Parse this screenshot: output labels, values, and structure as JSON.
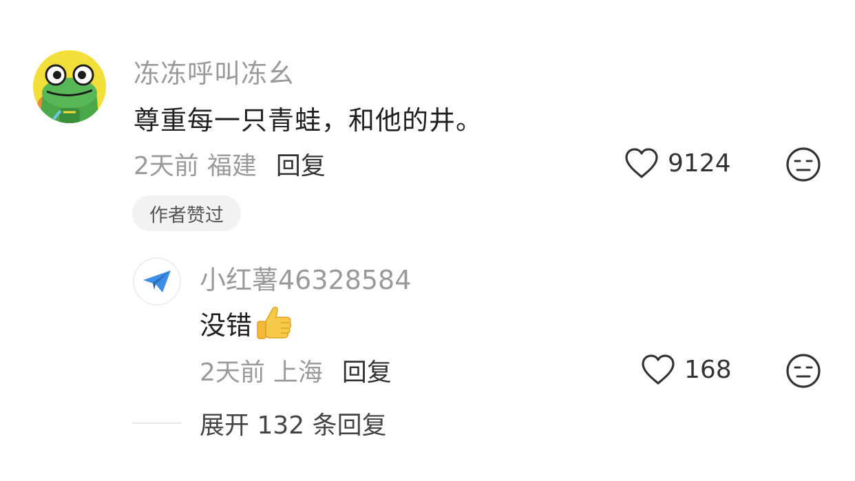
{
  "comment": {
    "username": "冻冻呼叫冻幺",
    "text": "尊重每一只青蛙，和他的井。",
    "time": "2天前",
    "location": "福建",
    "reply_label": "回复",
    "like_count": "9124",
    "author_badge": "作者赞过",
    "avatar_icon": "frog-avatar"
  },
  "reply": {
    "username": "小红薯46328584",
    "text": "没错",
    "emoji": "thumbs-up",
    "time": "2天前",
    "location": "上海",
    "reply_label": "回复",
    "like_count": "168",
    "avatar_icon": "paper-plane-icon"
  },
  "expand_label": "展开 132 条回复",
  "icons": {
    "like": "heart-outline-icon",
    "dislike": "neutral-face-icon"
  }
}
